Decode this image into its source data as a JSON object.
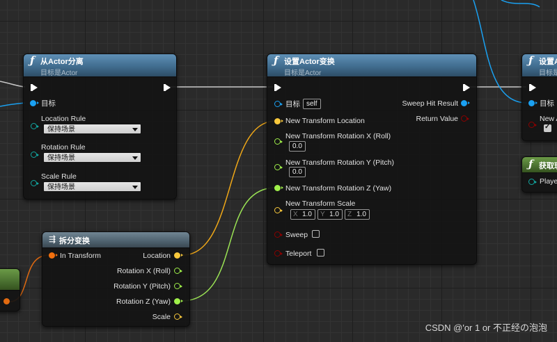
{
  "colors": {
    "exec": "#ffffff",
    "object": "#1ba1f2",
    "transform": "#f2a818",
    "float": "#a0f04a",
    "vector": "#f8c83c",
    "bool": "#8b0000",
    "struct": "#12a6a0",
    "wire_transform": "#f0a818",
    "wire_float": "#9ae254",
    "wire_object": "#1aa0f0",
    "wire_exec": "#c8c8c8",
    "wire_orange": "#e26a10"
  },
  "detach_node": {
    "title": "从Actor分离",
    "subtitle": "目标是Actor",
    "icon": "function-icon",
    "target_label": "目标",
    "location_rule_label": "Location Rule",
    "location_rule_value": "保持场景",
    "rotation_rule_label": "Rotation Rule",
    "rotation_rule_value": "保持场景",
    "scale_rule_label": "Scale Rule",
    "scale_rule_value": "保持场景"
  },
  "set_transform_node": {
    "title": "设置Actor变换",
    "subtitle": "目标是Actor",
    "icon": "function-icon",
    "target_label": "目标",
    "target_value": "self",
    "new_location_label": "New Transform Location",
    "rot_x_label": "New Transform Rotation X (Roll)",
    "rot_x_value": "0.0",
    "rot_y_label": "New Transform Rotation Y (Pitch)",
    "rot_y_value": "0.0",
    "rot_z_label": "New Transform Rotation Z (Yaw)",
    "scale_label": "New Transform Scale",
    "scale_x_label": "X",
    "scale_x_value": "1.0",
    "scale_y_label": "Y",
    "scale_y_value": "1.0",
    "scale_z_label": "Z",
    "scale_z_value": "1.0",
    "sweep_label": "Sweep",
    "sweep_checked": false,
    "teleport_label": "Teleport",
    "teleport_checked": false,
    "sweep_hit_label": "Sweep Hit Result",
    "return_label": "Return Value"
  },
  "partial_set_node": {
    "title": "设置A",
    "subtitle": "目标是",
    "target_label": "目标",
    "new_label": "New A",
    "checked": true
  },
  "get_node": {
    "title": "获取玩",
    "player_label": "Playe"
  },
  "break_node": {
    "title": "拆分变换",
    "icon": "break-struct-icon",
    "in_label": "In Transform",
    "location_label": "Location",
    "rot_x_label": "Rotation X (Roll)",
    "rot_y_label": "Rotation Y (Pitch)",
    "rot_z_label": "Rotation Z (Yaw)",
    "scale_label": "Scale"
  },
  "watermark": "CSDN @'or 1 or 不正经の泡泡"
}
